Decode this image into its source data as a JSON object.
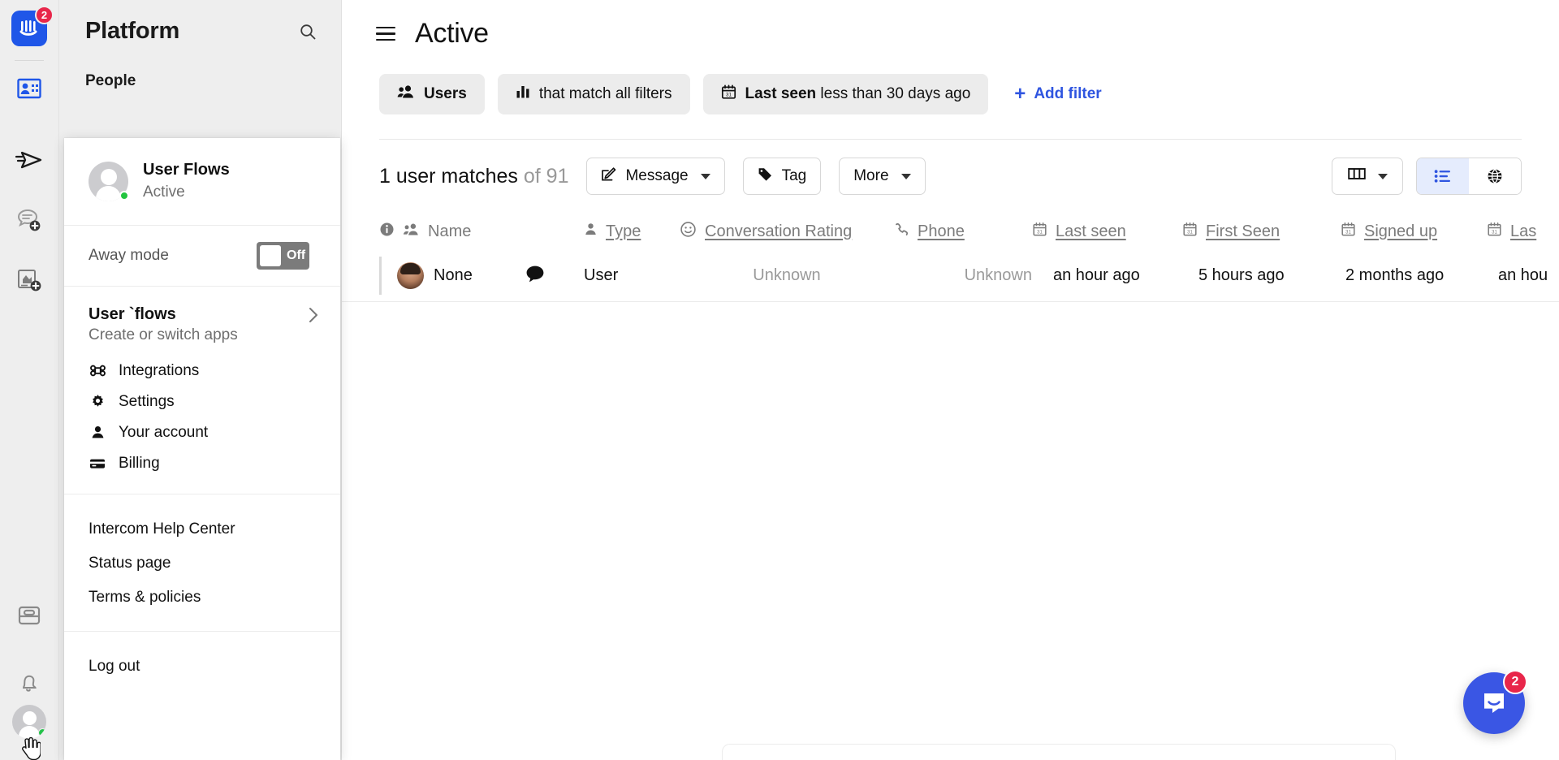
{
  "rail": {
    "logo_badge": "2",
    "icons": [
      {
        "name": "platform-logo-icon",
        "label": "Intercom"
      },
      {
        "name": "contacts-icon",
        "label": "Contacts"
      },
      {
        "name": "outbound-send-icon",
        "label": "Outbound"
      },
      {
        "name": "new-conversation-icon",
        "label": "New conversation"
      },
      {
        "name": "new-article-icon",
        "label": "New article"
      },
      {
        "name": "inbox-icon",
        "label": "Inbox"
      },
      {
        "name": "notifications-bell-icon",
        "label": "Notifications"
      },
      {
        "name": "user-avatar",
        "label": "Your profile"
      }
    ]
  },
  "sidebar": {
    "title": "Platform",
    "search_icon": "search-icon",
    "section_label": "People"
  },
  "account_panel": {
    "user_name": "User Flows",
    "user_status": "Active",
    "away_mode_label": "Away mode",
    "away_mode_value": "Off",
    "app_name": "User `flows",
    "app_sub": "Create or switch apps",
    "menu_items": [
      {
        "label": "Integrations",
        "icon": "command-icon"
      },
      {
        "label": "Settings",
        "icon": "gear-icon"
      },
      {
        "label": "Your account",
        "icon": "person-icon"
      },
      {
        "label": "Billing",
        "icon": "credit-card-icon"
      }
    ],
    "links": [
      {
        "label": "Intercom Help Center"
      },
      {
        "label": "Status page"
      },
      {
        "label": "Terms & policies"
      }
    ],
    "logout_label": "Log out"
  },
  "main": {
    "title": "Active",
    "menu_icon": "hamburger-icon",
    "filters": [
      {
        "icon": "users-icon",
        "bold": "Users",
        "rest": ""
      },
      {
        "icon": "bar-chart-icon",
        "bold": "",
        "rest": "that match all filters"
      },
      {
        "icon": "calendar-icon",
        "bold": "Last seen",
        "rest": " less than 30 days ago"
      }
    ],
    "add_filter_label": "Add filter",
    "add_filter_plus": "+",
    "match_count": "1 user matches",
    "match_total": "of 91",
    "buttons": [
      {
        "label": "Message",
        "icon": "compose-icon",
        "caret": true
      },
      {
        "label": "Tag",
        "icon": "tag-icon",
        "caret": false
      },
      {
        "label": "More",
        "icon": "",
        "caret": true
      }
    ],
    "columns_button_icon": "columns-icon",
    "view_list_icon": "list-view-icon",
    "view_globe_icon": "globe-view-icon"
  },
  "table": {
    "columns": [
      {
        "key": "name",
        "label": "Name",
        "icon": "users-icon",
        "lead_icon": "info-icon",
        "underline": false
      },
      {
        "key": "type",
        "label": "Type",
        "icon": "person-icon",
        "underline": true
      },
      {
        "key": "rating",
        "label": "Conversation Rating",
        "icon": "smiley-icon",
        "underline": true
      },
      {
        "key": "phone",
        "label": "Phone",
        "icon": "phone-icon",
        "underline": true
      },
      {
        "key": "last_seen",
        "label": "Last seen",
        "icon": "calendar-icon",
        "underline": true
      },
      {
        "key": "first_seen",
        "label": "First Seen",
        "icon": "calendar-icon",
        "underline": true
      },
      {
        "key": "signed_up",
        "label": "Signed up",
        "icon": "calendar-icon",
        "underline": true
      },
      {
        "key": "last_contacted",
        "label": "Las",
        "icon": "calendar-icon",
        "underline": true
      }
    ],
    "rows": [
      {
        "name": "None",
        "chat_icon": "chat-bubble-icon",
        "type": "User",
        "rating": "Unknown",
        "phone": "Unknown",
        "last_seen": "an hour ago",
        "first_seen": "5 hours ago",
        "signed_up": "2 months ago",
        "last_contacted": "an hou"
      }
    ]
  },
  "messenger": {
    "badge": "2",
    "icon": "messenger-icon"
  },
  "colors": {
    "brand_blue": "#1f56e8",
    "accent_link": "#2f55e0",
    "badge_red": "#e8264a",
    "status_green": "#22c43f",
    "sidebar_bg": "#eeeeee"
  }
}
